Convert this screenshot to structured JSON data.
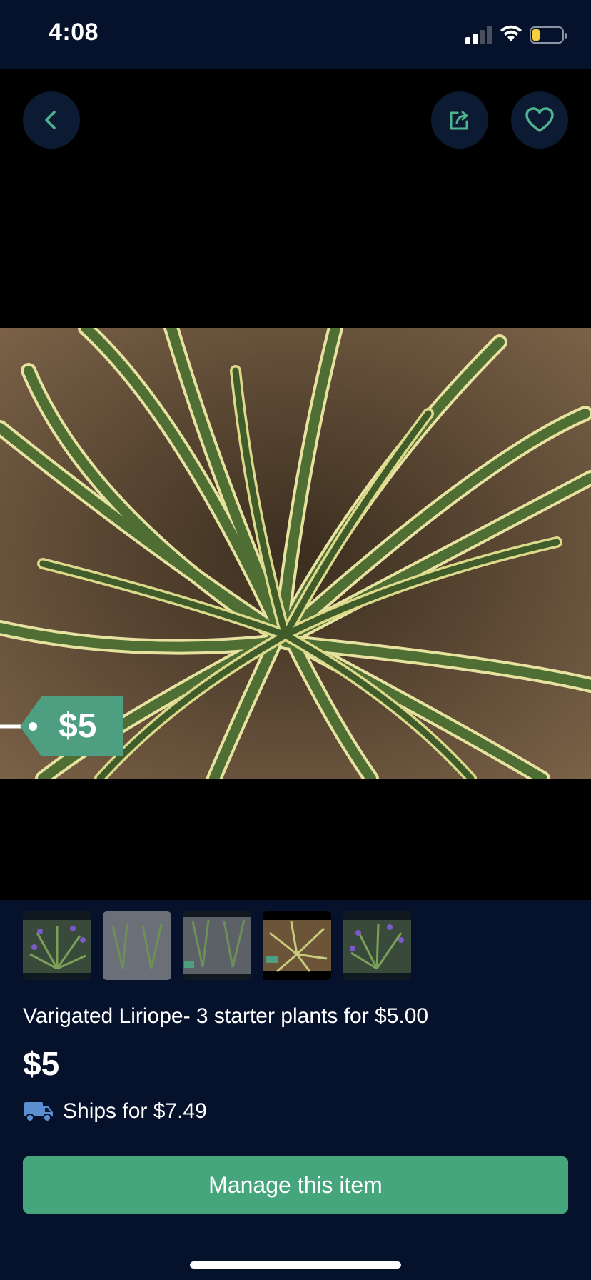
{
  "status_bar": {
    "time": "4:08",
    "battery_level": 0.25,
    "signal_bars_active": 2,
    "signal_bars_total": 4
  },
  "nav": {
    "back_icon": "chevron-left-icon",
    "share_icon": "share-icon",
    "favorite_icon": "heart-outline-icon"
  },
  "photo": {
    "price_tag": "$5",
    "tag_color": "#4e9e82"
  },
  "thumbnails": [
    {
      "name": "thumbnail-1",
      "selected": false
    },
    {
      "name": "thumbnail-2",
      "selected": false
    },
    {
      "name": "thumbnail-3",
      "selected": false
    },
    {
      "name": "thumbnail-4",
      "selected": true
    },
    {
      "name": "thumbnail-5",
      "selected": false
    }
  ],
  "listing": {
    "title": "Varigated Liriope- 3 starter plants for $5.00",
    "price": "$5",
    "shipping": "Ships for $7.49"
  },
  "actions": {
    "manage_label": "Manage this item"
  },
  "colors": {
    "background": "#06112b",
    "accent": "#45a57b",
    "nav_button": "#0d1a33",
    "icon_accent": "#4fb38d"
  }
}
